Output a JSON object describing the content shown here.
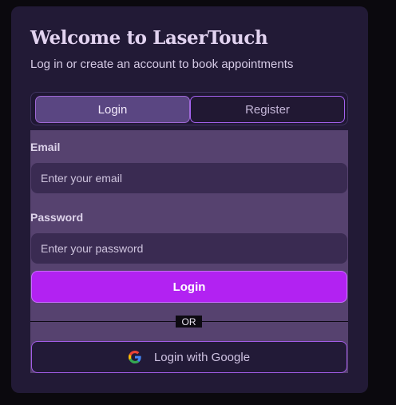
{
  "card": {
    "title": "Welcome to LaserTouch",
    "subtitle": "Log in or create an account to book appointments"
  },
  "tabs": [
    {
      "label": "Login",
      "active": true
    },
    {
      "label": "Register",
      "active": false
    }
  ],
  "form": {
    "email": {
      "label": "Email",
      "placeholder": "Enter your email",
      "value": ""
    },
    "password": {
      "label": "Password",
      "placeholder": "Enter your password",
      "value": ""
    },
    "submit_label": "Login",
    "divider_text": "OR",
    "google_label": "Login with Google",
    "google_icon": "google-g-icon"
  },
  "colors": {
    "page_background": "#0b090e",
    "card_background": "#221a36",
    "form_background": "#56426f",
    "primary_button": "#b222f2",
    "accent_border": "#a562f0"
  }
}
